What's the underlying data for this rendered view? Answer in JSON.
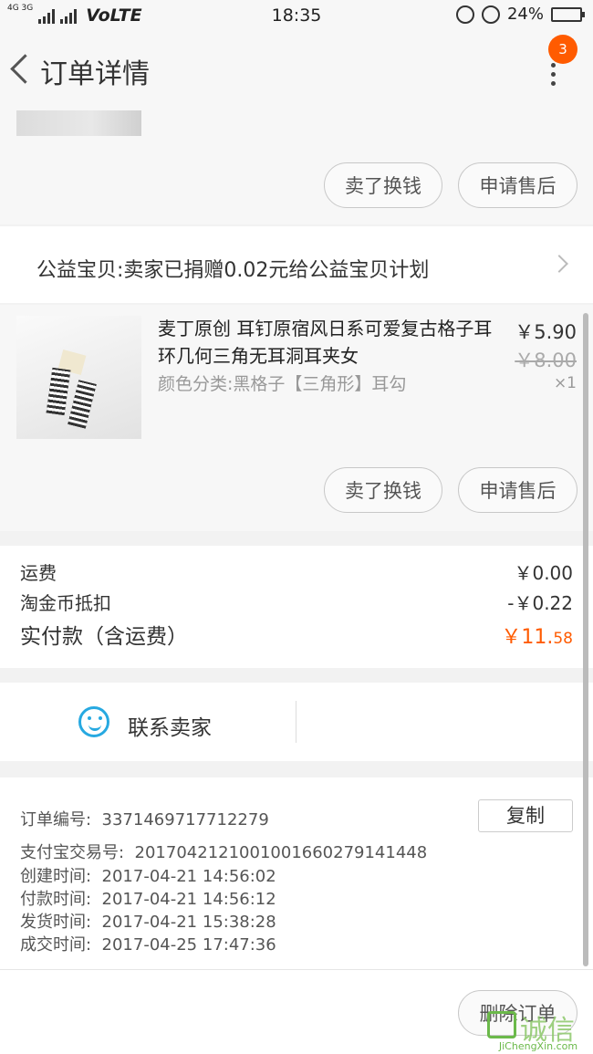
{
  "status_bar": {
    "network": "4G 3G",
    "volte": "VoLTE",
    "time": "18:35",
    "battery": "24%",
    "battery_level": 0.24
  },
  "nav": {
    "title": "订单详情",
    "badge_count": "3"
  },
  "item1_actions": {
    "sell": "卖了换钱",
    "after_sale": "申请售后"
  },
  "charity": {
    "text": "公益宝贝:卖家已捐赠0.02元给公益宝贝计划"
  },
  "product": {
    "title": "麦丁原创 耳钉原宿风日系可爱复古格子耳环几何三角无耳洞耳夹女",
    "sku": "颜色分类:黑格子【三角形】耳勾",
    "price": "￥5.90",
    "original_price": "￥8.00",
    "quantity": "×1",
    "actions": {
      "sell": "卖了换钱",
      "after_sale": "申请售后"
    }
  },
  "fees": {
    "shipping_label": "运费",
    "shipping_value": "￥0.00",
    "coin_label": "淘金币抵扣",
    "coin_value": "-￥0.22",
    "paid_label": "实付款（含运费）",
    "paid_main": "￥11.",
    "paid_cents": "58"
  },
  "contact": {
    "label": "联系卖家"
  },
  "order_info": {
    "order_no_label": "订单编号:",
    "order_no": "3371469717712279",
    "copy": "复制",
    "alipay_label": "支付宝交易号:",
    "alipay_no": "2017042121001001660279141448",
    "created_label": "创建时间:",
    "created": "2017-04-21  14:56:02",
    "paid_label": "付款时间:",
    "paid": "2017-04-21  14:56:12",
    "shipped_label": "发货时间:",
    "shipped": "2017-04-21  15:38:28",
    "completed_label": "成交时间:",
    "completed": "2017-04-25  17:47:36"
  },
  "bottom": {
    "delete_order": "删除订单"
  },
  "watermark": {
    "text": "诚信",
    "sub": "JiChengXin.com"
  },
  "colors": {
    "accent": "#ff5b00",
    "icon_blue": "#27a9e1"
  }
}
